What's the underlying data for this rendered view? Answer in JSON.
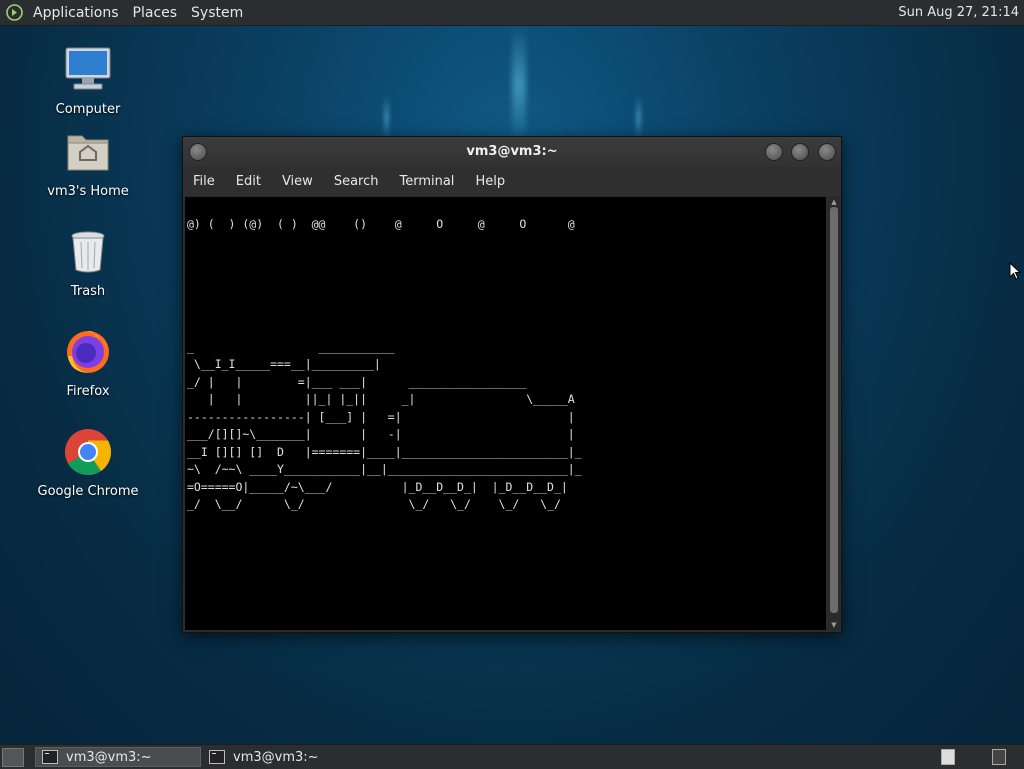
{
  "top_panel": {
    "menus": [
      "Applications",
      "Places",
      "System"
    ],
    "clock": "Sun Aug 27, 21:14"
  },
  "desktop_icons": [
    {
      "label": "Computer",
      "icon": "computer-icon"
    },
    {
      "label": "vm3's Home",
      "icon": "home-folder-icon"
    },
    {
      "label": "Trash",
      "icon": "trash-icon"
    },
    {
      "label": "Firefox",
      "icon": "firefox-icon"
    },
    {
      "label": "Google Chrome",
      "icon": "chrome-icon"
    }
  ],
  "window": {
    "title": "vm3@vm3:~",
    "menu": [
      "File",
      "Edit",
      "View",
      "Search",
      "Terminal",
      "Help"
    ],
    "terminal_lines": [
      "@) (  ) (@)  ( )  @@    ()    @     O     @     O      @",
      "",
      "",
      "",
      "",
      "",
      "",
      "_                  ___________",
      " \\__I_I_____===__|_________|",
      "_/ |   |        =|___ ___|      _________________",
      "   |   |         ||_| |_||     _|                \\_____A",
      "-----------------| [___] |   =|                        |",
      "___/[][]~\\_______|       |   -|                        |",
      "__I [][] []  D   |=======|____|________________________|_",
      "~\\  /~~\\ ____Y___________|__|__________________________|_",
      "=O=====O|_____/~\\___/          |_D__D__D_|  |_D__D__D_|",
      "_/  \\__/      \\_/               \\_/   \\_/    \\_/   \\_/"
    ]
  },
  "taskbar": {
    "tasks": [
      {
        "label": "vm3@vm3:~",
        "active": true
      },
      {
        "label": "vm3@vm3:~",
        "active": false
      }
    ]
  }
}
